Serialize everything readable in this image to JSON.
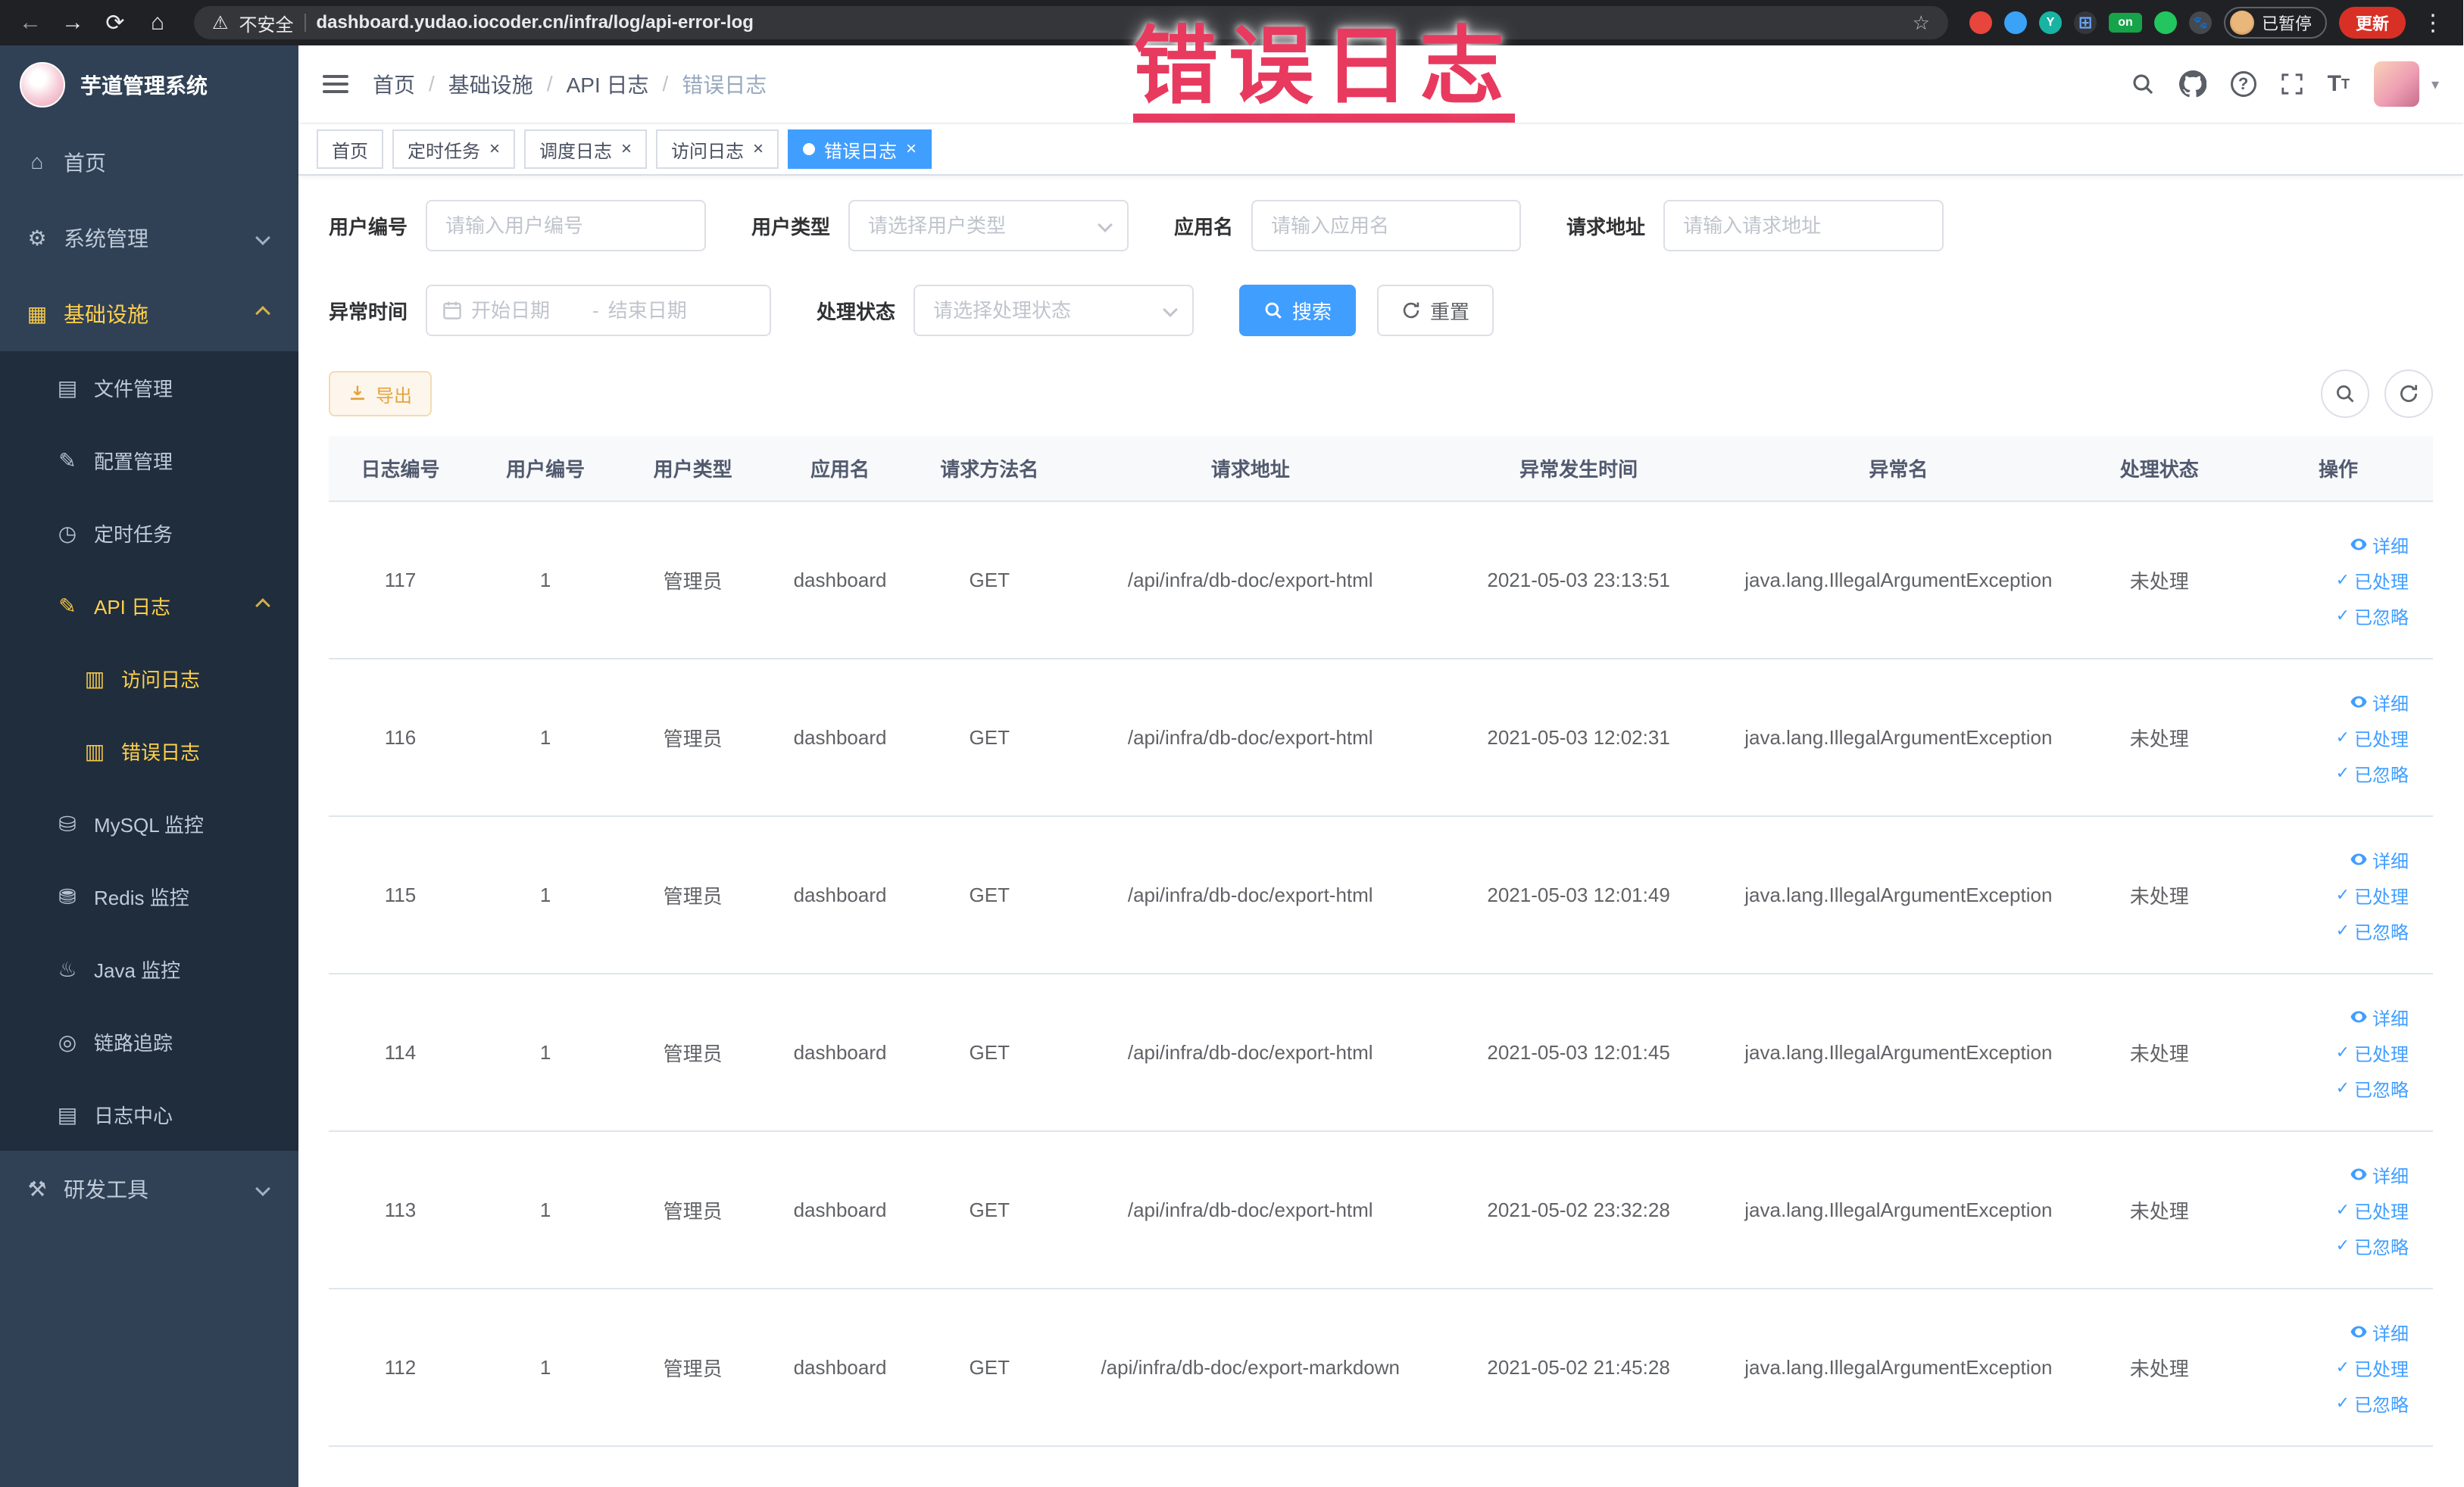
{
  "browser": {
    "security_label": "不安全",
    "url": "dashboard.yudao.iocoder.cn/infra/log/api-error-log",
    "paused_label": "已暂停",
    "update_label": "更新"
  },
  "annotation": {
    "text": "错误日志"
  },
  "colors": {
    "accent": "#409EFF",
    "sidebar_bg": "#304156",
    "submenu_bg": "#1f2d3d",
    "active_menu_text": "#ffd04b",
    "warning": "#e6a23c",
    "annotation_red": "#e8395f",
    "chrome_bg": "#202124"
  },
  "sidebar": {
    "app_title": "芋道管理系统",
    "items": [
      {
        "key": "home",
        "label": "首页",
        "icon": "home",
        "level": 0
      },
      {
        "key": "system",
        "label": "系统管理",
        "icon": "gear",
        "level": 0,
        "arrow": "down"
      },
      {
        "key": "infra",
        "label": "基础设施",
        "icon": "monitor",
        "level": 0,
        "arrow": "up",
        "active": true
      },
      {
        "key": "file",
        "label": "文件管理",
        "icon": "folder",
        "level": 1
      },
      {
        "key": "config",
        "label": "配置管理",
        "icon": "edit",
        "level": 1
      },
      {
        "key": "job",
        "label": "定时任务",
        "icon": "clock",
        "level": 1
      },
      {
        "key": "api-log",
        "label": "API 日志",
        "icon": "log",
        "level": 1,
        "arrow": "up",
        "active": true
      },
      {
        "key": "access-log",
        "label": "访问日志",
        "icon": "doc",
        "level": 2,
        "active": true
      },
      {
        "key": "error-log",
        "label": "错误日志",
        "icon": "doc",
        "level": 2,
        "active": true
      },
      {
        "key": "mysql",
        "label": "MySQL 监控",
        "icon": "database",
        "level": 1
      },
      {
        "key": "redis",
        "label": "Redis 监控",
        "icon": "redis",
        "level": 1
      },
      {
        "key": "java",
        "label": "Java 监控",
        "icon": "java",
        "level": 1
      },
      {
        "key": "trace",
        "label": "链路追踪",
        "icon": "eye",
        "level": 1
      },
      {
        "key": "log-center",
        "label": "日志中心",
        "icon": "log-center",
        "level": 1
      },
      {
        "key": "dev-tools",
        "label": "研发工具",
        "icon": "tools",
        "level": 0,
        "arrow": "down"
      }
    ]
  },
  "header": {
    "breadcrumb": [
      "首页",
      "基础设施",
      "API 日志",
      "错误日志"
    ]
  },
  "tabs": [
    {
      "key": "home",
      "label": "首页",
      "closable": false,
      "active": false
    },
    {
      "key": "job",
      "label": "定时任务",
      "closable": true,
      "active": false
    },
    {
      "key": "job-log",
      "label": "调度日志",
      "closable": true,
      "active": false
    },
    {
      "key": "access-log",
      "label": "访问日志",
      "closable": true,
      "active": false
    },
    {
      "key": "error-log",
      "label": "错误日志",
      "closable": true,
      "active": true
    }
  ],
  "filters": {
    "user_id": {
      "label": "用户编号",
      "placeholder": "请输入用户编号"
    },
    "user_type": {
      "label": "用户类型",
      "placeholder": "请选择用户类型"
    },
    "app_name": {
      "label": "应用名",
      "placeholder": "请输入应用名"
    },
    "request_url": {
      "label": "请求地址",
      "placeholder": "请输入请求地址"
    },
    "exception_time": {
      "label": "异常时间",
      "start_placeholder": "开始日期",
      "separator": "-",
      "end_placeholder": "结束日期"
    },
    "process_status": {
      "label": "处理状态",
      "placeholder": "请选择处理状态"
    },
    "search_button": "搜索",
    "reset_button": "重置"
  },
  "toolbar": {
    "export_label": "导出"
  },
  "table": {
    "columns": [
      "日志编号",
      "用户编号",
      "用户类型",
      "应用名",
      "请求方法名",
      "请求地址",
      "异常发生时间",
      "异常名",
      "处理状态",
      "操作"
    ],
    "row_actions": [
      "详细",
      "已处理",
      "已忽略"
    ],
    "rows": [
      [
        "117",
        "1",
        "管理员",
        "dashboard",
        "GET",
        "/api/infra/db-doc/export-html",
        "2021-05-03 23:13:51",
        "java.lang.IllegalArgumentException",
        "未处理"
      ],
      [
        "116",
        "1",
        "管理员",
        "dashboard",
        "GET",
        "/api/infra/db-doc/export-html",
        "2021-05-03 12:02:31",
        "java.lang.IllegalArgumentException",
        "未处理"
      ],
      [
        "115",
        "1",
        "管理员",
        "dashboard",
        "GET",
        "/api/infra/db-doc/export-html",
        "2021-05-03 12:01:49",
        "java.lang.IllegalArgumentException",
        "未处理"
      ],
      [
        "114",
        "1",
        "管理员",
        "dashboard",
        "GET",
        "/api/infra/db-doc/export-html",
        "2021-05-03 12:01:45",
        "java.lang.IllegalArgumentException",
        "未处理"
      ],
      [
        "113",
        "1",
        "管理员",
        "dashboard",
        "GET",
        "/api/infra/db-doc/export-html",
        "2021-05-02 23:32:28",
        "java.lang.IllegalArgumentException",
        "未处理"
      ],
      [
        "112",
        "1",
        "管理员",
        "dashboard",
        "GET",
        "/api/infra/db-doc/export-markdown",
        "2021-05-02 21:45:28",
        "java.lang.IllegalArgumentException",
        "未处理"
      ]
    ]
  }
}
